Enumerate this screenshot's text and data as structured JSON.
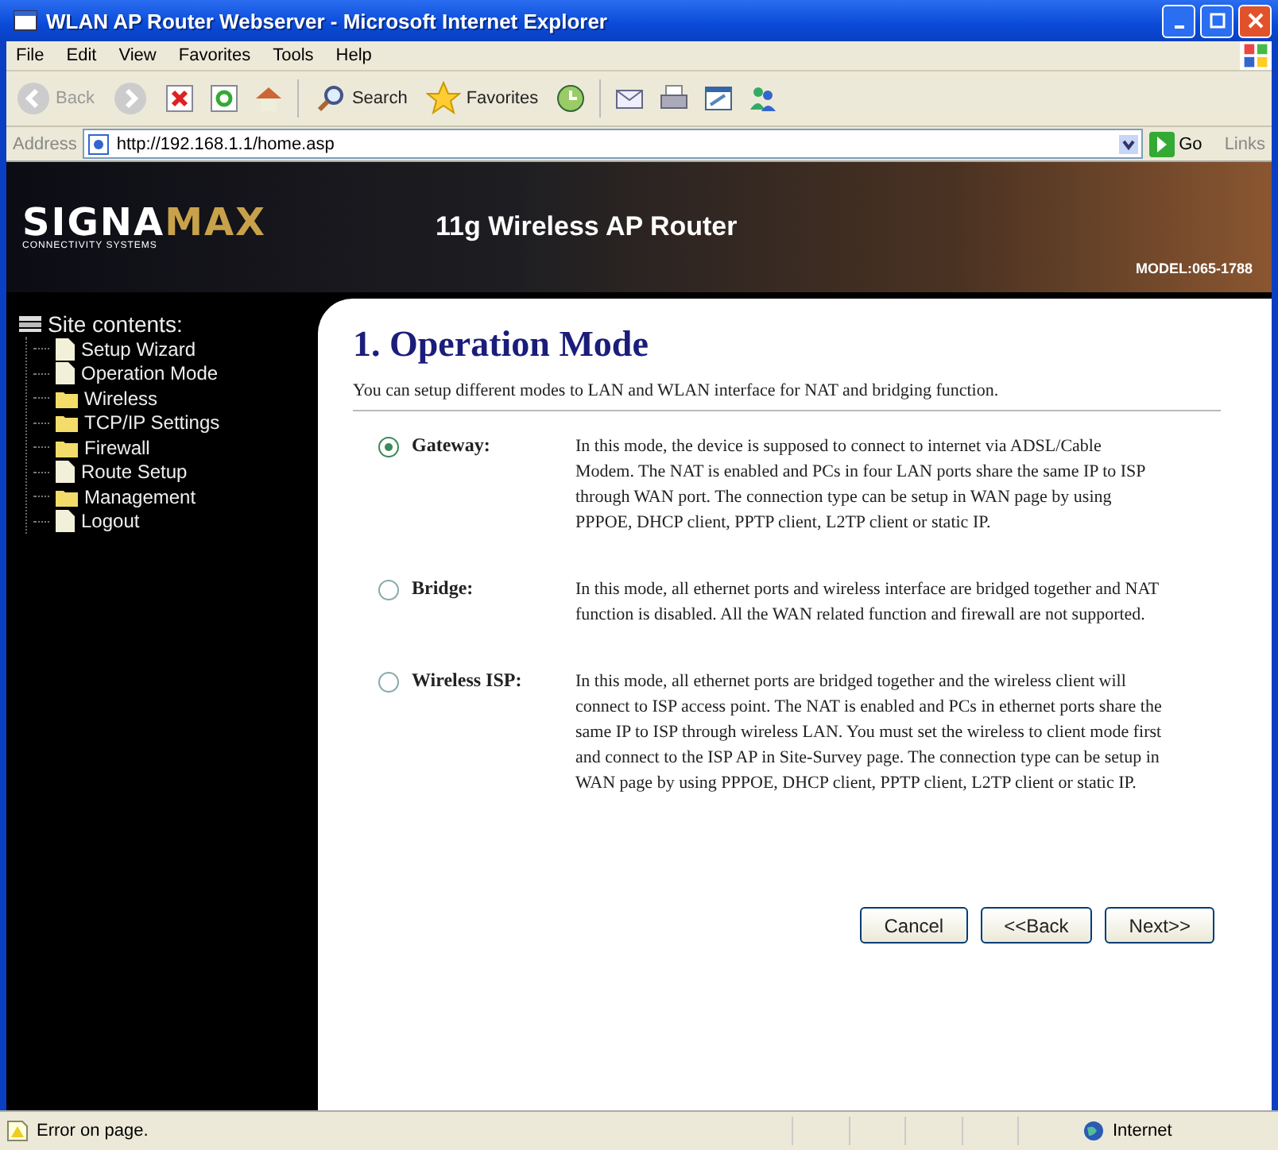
{
  "window": {
    "title": "WLAN AP Router Webserver - Microsoft Internet Explorer"
  },
  "menu": [
    "File",
    "Edit",
    "View",
    "Favorites",
    "Tools",
    "Help"
  ],
  "toolbar": {
    "back": "Back",
    "search": "Search",
    "favorites": "Favorites"
  },
  "address_bar": {
    "label": "Address",
    "url": "http://192.168.1.1/home.asp",
    "go": "Go",
    "links": "Links"
  },
  "header": {
    "logo_main": "SIGNA",
    "logo_accent": "MAX",
    "logo_sub": "CONNECTIVITY SYSTEMS",
    "title": "11g Wireless AP Router",
    "model": "MODEL:065-1788"
  },
  "sidebar": {
    "title": "Site contents:",
    "items": [
      {
        "label": "Setup Wizard",
        "kind": "page"
      },
      {
        "label": "Operation Mode",
        "kind": "page"
      },
      {
        "label": "Wireless",
        "kind": "folder"
      },
      {
        "label": "TCP/IP Settings",
        "kind": "folder"
      },
      {
        "label": "Firewall",
        "kind": "folder"
      },
      {
        "label": "Route Setup",
        "kind": "page"
      },
      {
        "label": "Management",
        "kind": "folder"
      },
      {
        "label": "Logout",
        "kind": "page"
      }
    ]
  },
  "content": {
    "heading": "1. Operation Mode",
    "intro": "You can setup different modes to LAN and WLAN interface for NAT and bridging function.",
    "modes": [
      {
        "label": "Gateway:",
        "selected": true,
        "description": "In this mode, the device is supposed to connect to internet via ADSL/Cable Modem. The NAT is enabled and PCs in four LAN ports share the same IP to ISP through WAN port. The connection type can be setup in WAN page by using PPPOE, DHCP client, PPTP client, L2TP client or static IP."
      },
      {
        "label": "Bridge:",
        "selected": false,
        "description": "In this mode, all ethernet ports and wireless interface are bridged together and NAT function is disabled. All the WAN related function and firewall are not supported."
      },
      {
        "label": "Wireless ISP:",
        "selected": false,
        "description": "In this mode, all ethernet ports are bridged together and the wireless client will connect to ISP access point. The NAT is enabled and PCs in ethernet ports share the same IP to ISP through wireless LAN. You must set the wireless to client mode first and connect to the ISP AP in Site-Survey page. The connection type can be setup in WAN page by using PPPOE, DHCP client, PPTP client, L2TP client or static IP."
      }
    ],
    "buttons": [
      "Cancel",
      "<<Back",
      "Next>>"
    ]
  },
  "status_bar": {
    "message": "Error on page.",
    "zone": "Internet"
  }
}
